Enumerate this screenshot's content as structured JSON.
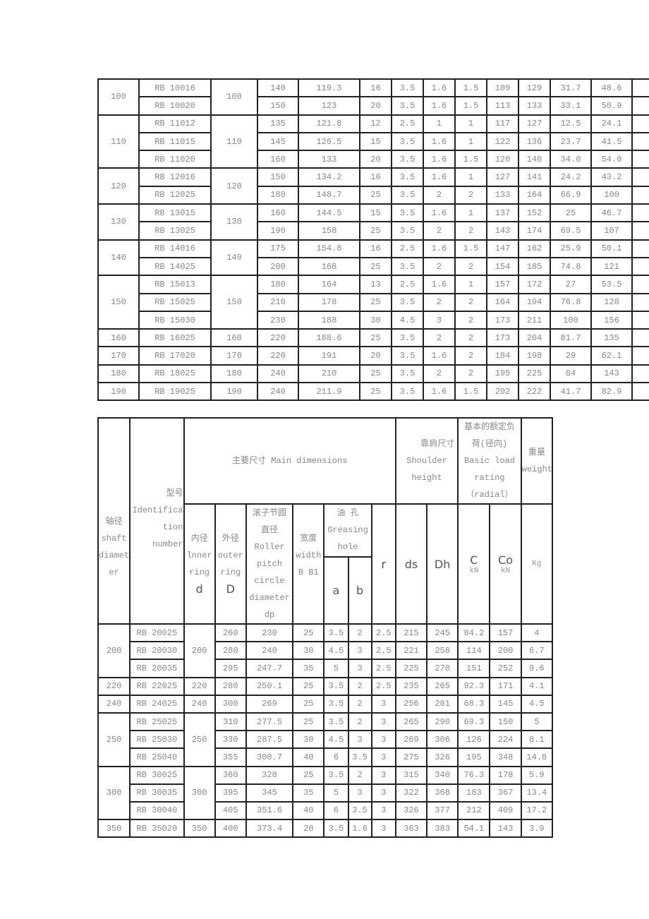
{
  "table1": {
    "groups": [
      {
        "shaft": "100",
        "d": "100",
        "rows": [
          [
            "RB 10016",
            "140",
            "119.3",
            "16",
            "3.5",
            "1.6",
            "1.5",
            "109",
            "129",
            "31.7",
            "48.6"
          ],
          [
            "RB 10020",
            "150",
            "123",
            "20",
            "3.5",
            "1.6",
            "1.5",
            "113",
            "133",
            "33.1",
            "50.9"
          ]
        ]
      },
      {
        "shaft": "110",
        "d": "110",
        "rows": [
          [
            "RB 11012",
            "135",
            "121.8",
            "12",
            "2.5",
            "1",
            "1",
            "117",
            "127",
            "12.5",
            "24.1"
          ],
          [
            "RB 11015",
            "145",
            "126.5",
            "15",
            "3.5",
            "1.6",
            "1",
            "122",
            "136",
            "23.7",
            "41.5"
          ],
          [
            "RB 11020",
            "160",
            "133",
            "20",
            "3.5",
            "1.6",
            "1.5",
            "120",
            "140",
            "34.0",
            "54.0"
          ]
        ]
      },
      {
        "shaft": "120",
        "d": "120",
        "rows": [
          [
            "RB 12016",
            "150",
            "134.2",
            "16",
            "3.5",
            "1.6",
            "1",
            "127",
            "141",
            "24.2",
            "43.2"
          ],
          [
            "RB 12025",
            "180",
            "148.7",
            "25",
            "3.5",
            "2",
            "2",
            "133",
            "164",
            "66.9",
            "100"
          ]
        ]
      },
      {
        "shaft": "130",
        "d": "130",
        "rows": [
          [
            "RB 13015",
            "160",
            "144.5",
            "15",
            "3.5",
            "1.6",
            "1",
            "137",
            "152",
            "25",
            "46.7"
          ],
          [
            "RB 13025",
            "190",
            "158",
            "25",
            "3.5",
            "2",
            "2",
            "143",
            "174",
            "69.5",
            "107"
          ]
        ]
      },
      {
        "shaft": "140",
        "d": "140",
        "rows": [
          [
            "RB 14016",
            "175",
            "154.8",
            "16",
            "2.5",
            "1.6",
            "1.5",
            "147",
            "162",
            "25.9",
            "50.1"
          ],
          [
            "RB 14025",
            "200",
            "168",
            "25",
            "3.5",
            "2",
            "2",
            "154",
            "185",
            "74.8",
            "121"
          ]
        ]
      },
      {
        "shaft": "150",
        "d": "150",
        "rows": [
          [
            "RB 15013",
            "180",
            "164",
            "13",
            "2.5",
            "1.6",
            "1",
            "157",
            "172",
            "27",
            "53.5"
          ],
          [
            "RB 15025",
            "210",
            "178",
            "25",
            "3.5",
            "2",
            "2",
            "164",
            "194",
            "76.8",
            "128"
          ],
          [
            "RB 15030",
            "230",
            "188",
            "30",
            "4.5",
            "3",
            "2",
            "173",
            "211",
            "100",
            "156"
          ]
        ]
      },
      {
        "shaft": "160",
        "d": "160",
        "rows": [
          [
            "RB 16025",
            "220",
            "188.6",
            "25",
            "3.5",
            "2",
            "2",
            "173",
            "204",
            "81.7",
            "135"
          ]
        ]
      },
      {
        "shaft": "170",
        "d": "170",
        "rows": [
          [
            "RB 17020",
            "220",
            "191",
            "20",
            "3.5",
            "1.6",
            "2",
            "184",
            "198",
            "29",
            "62.1"
          ]
        ]
      },
      {
        "shaft": "180",
        "d": "180",
        "rows": [
          [
            "RB 18025",
            "240",
            "210",
            "25",
            "3.5",
            "2",
            "2",
            "195",
            "225",
            "84",
            "143"
          ]
        ]
      },
      {
        "shaft": "190",
        "d": "190",
        "rows": [
          [
            "RB 19025",
            "240",
            "211.9",
            "25",
            "3.5",
            "1.6",
            "1.5",
            "202",
            "222",
            "41.7",
            "82.9"
          ]
        ]
      }
    ]
  },
  "table2": {
    "header": {
      "shaft": [
        "轴径",
        "shaft",
        "diamet",
        "er"
      ],
      "id": [
        "型号",
        "Identifica",
        "tion number"
      ],
      "main": "主要尺寸 Main dimensions",
      "shoulder": [
        "靠肩尺寸",
        "Shoulder",
        "height"
      ],
      "load": [
        "基本的额定负",
        "荷(径向)",
        "Basic load",
        "rating",
        "（radial）"
      ],
      "weight": [
        "重量",
        "weight"
      ],
      "d": [
        "内径",
        "lnner",
        "ring",
        "d"
      ],
      "D": [
        "外径",
        "outer",
        "ring",
        "D"
      ],
      "dp": [
        "滚子节圆",
        "直径",
        "Roller",
        "pitch",
        "circle",
        "diameter",
        "dp"
      ],
      "width": [
        "宽度",
        "width",
        "B B1"
      ],
      "grease": [
        "油 孔",
        "Greasing",
        "hole"
      ],
      "a": "a",
      "b": "b",
      "r": "r",
      "ds": "ds",
      "Dh": "Dh",
      "C": "C",
      "Co": "Co",
      "kN": "kN",
      "Kg": "Kg"
    },
    "groups": [
      {
        "shaft": "200",
        "d": "200",
        "rows": [
          [
            "RB 20025",
            "260",
            "230",
            "25",
            "3.5",
            "2",
            "2.5",
            "215",
            "245",
            "84.2",
            "157",
            "4"
          ],
          [
            "RB 20030",
            "280",
            "240",
            "30",
            "4.5",
            "3",
            "2.5",
            "221",
            "258",
            "114",
            "200",
            "6.7"
          ],
          [
            "RB 20035",
            "295",
            "247.7",
            "35",
            "5",
            "3",
            "2.5",
            "225",
            "270",
            "151",
            "252",
            "9.6"
          ]
        ]
      },
      {
        "shaft": "220",
        "d": "220",
        "rows": [
          [
            "RB 22025",
            "280",
            "250.1",
            "25",
            "3.5",
            "2",
            "2.5",
            "235",
            "265",
            "92.3",
            "171",
            "4.1"
          ]
        ]
      },
      {
        "shaft": "240",
        "d": "240",
        "rows": [
          [
            "RB 24025",
            "300",
            "269",
            "25",
            "3.5",
            "2",
            "3",
            "256",
            "281",
            "68.3",
            "145",
            "4.5"
          ]
        ]
      },
      {
        "shaft": "250",
        "d": "250",
        "rows": [
          [
            "RB 25025",
            "310",
            "277.5",
            "25",
            "3.5",
            "2",
            "3",
            "265",
            "290",
            "69.3",
            "150",
            "5"
          ],
          [
            "RB 25030",
            "330",
            "287.5",
            "30",
            "4.5",
            "3",
            "3",
            "269",
            "306",
            "126",
            "224",
            "8.1"
          ],
          [
            "RB 25040",
            "355",
            "300.7",
            "40",
            "6",
            "3.5",
            "3",
            "275",
            "326",
            "195",
            "348",
            "14.8"
          ]
        ]
      },
      {
        "shaft": "300",
        "d": "300",
        "rows": [
          [
            "RB 30025",
            "360",
            "328",
            "25",
            "3.5",
            "2",
            "3",
            "315",
            "340",
            "76.3",
            "178",
            "5.9"
          ],
          [
            "RB 30035",
            "395",
            "345",
            "35",
            "5",
            "3",
            "3",
            "322",
            "368",
            "183",
            "367",
            "13.4"
          ],
          [
            "RB 30040",
            "405",
            "351.6",
            "40",
            "6",
            "3.5",
            "3",
            "326",
            "377",
            "212",
            "409",
            "17.2"
          ]
        ]
      },
      {
        "shaft": "350",
        "d": "350",
        "rows": [
          [
            "RB 35020",
            "400",
            "373.4",
            "20",
            "3.5",
            "1.6",
            "3",
            "363",
            "383",
            "54.1",
            "143",
            "3.9"
          ]
        ]
      }
    ]
  }
}
